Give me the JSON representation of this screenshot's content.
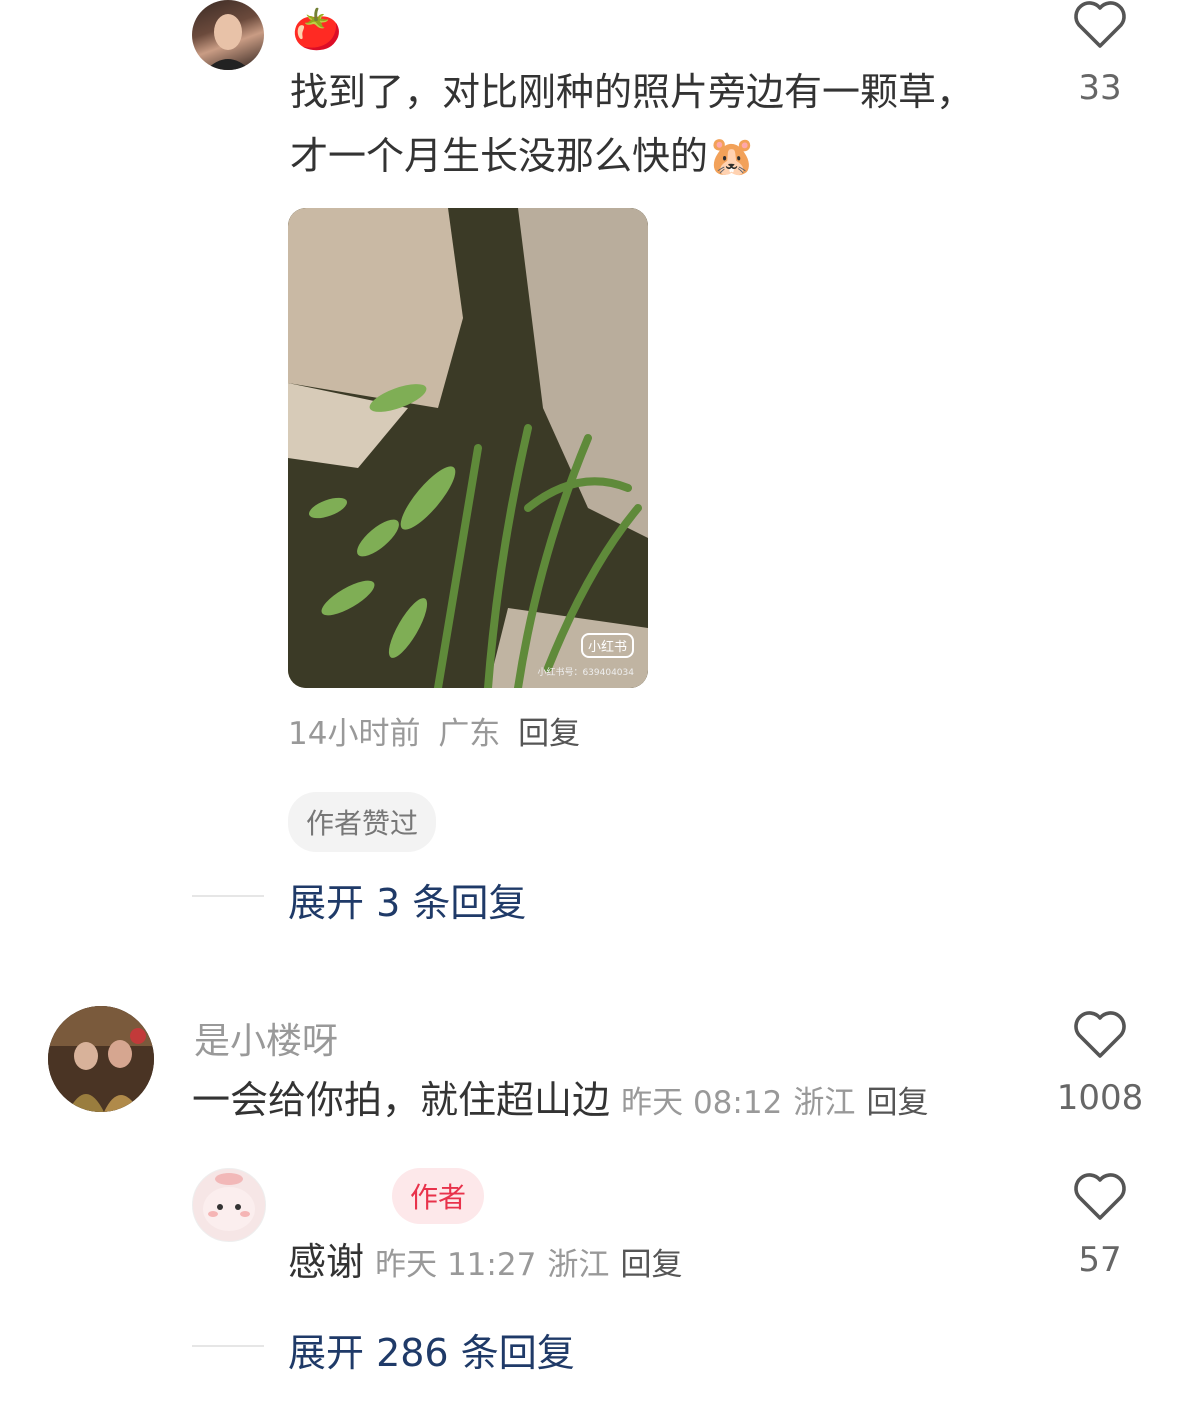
{
  "comments": [
    {
      "username": "",
      "username_emoji": "🍅",
      "text": "找到了，对比刚种的照片旁边有一颗草，才一个月生长没那么快的",
      "text_emoji": "🐹",
      "image_watermark": "小红书",
      "image_watermark_id": "小红书号：639404034",
      "meta_time": "14小时前",
      "meta_location": "广东",
      "reply_label": "回复",
      "badge": "作者赞过",
      "likes": "33",
      "expand_label": "展开 3 条回复"
    },
    {
      "username": "是小楼呀",
      "text": "一会给你拍，就住超山边",
      "meta_time": "昨天 08:12",
      "meta_location": "浙江",
      "reply_label": "回复",
      "likes": "1008"
    },
    {
      "username": "",
      "author_badge": "作者",
      "text": "感谢",
      "meta_time": "昨天 11:27",
      "meta_location": "浙江",
      "reply_label": "回复",
      "likes": "57",
      "expand_label": "展开 286 条回复"
    }
  ],
  "colors": {
    "accent_link": "#1f3a68",
    "author_badge": "#e8324b",
    "meta_text": "#999999"
  },
  "icons": [
    "heart-outline-icon",
    "tomato-emoji",
    "avatar"
  ]
}
